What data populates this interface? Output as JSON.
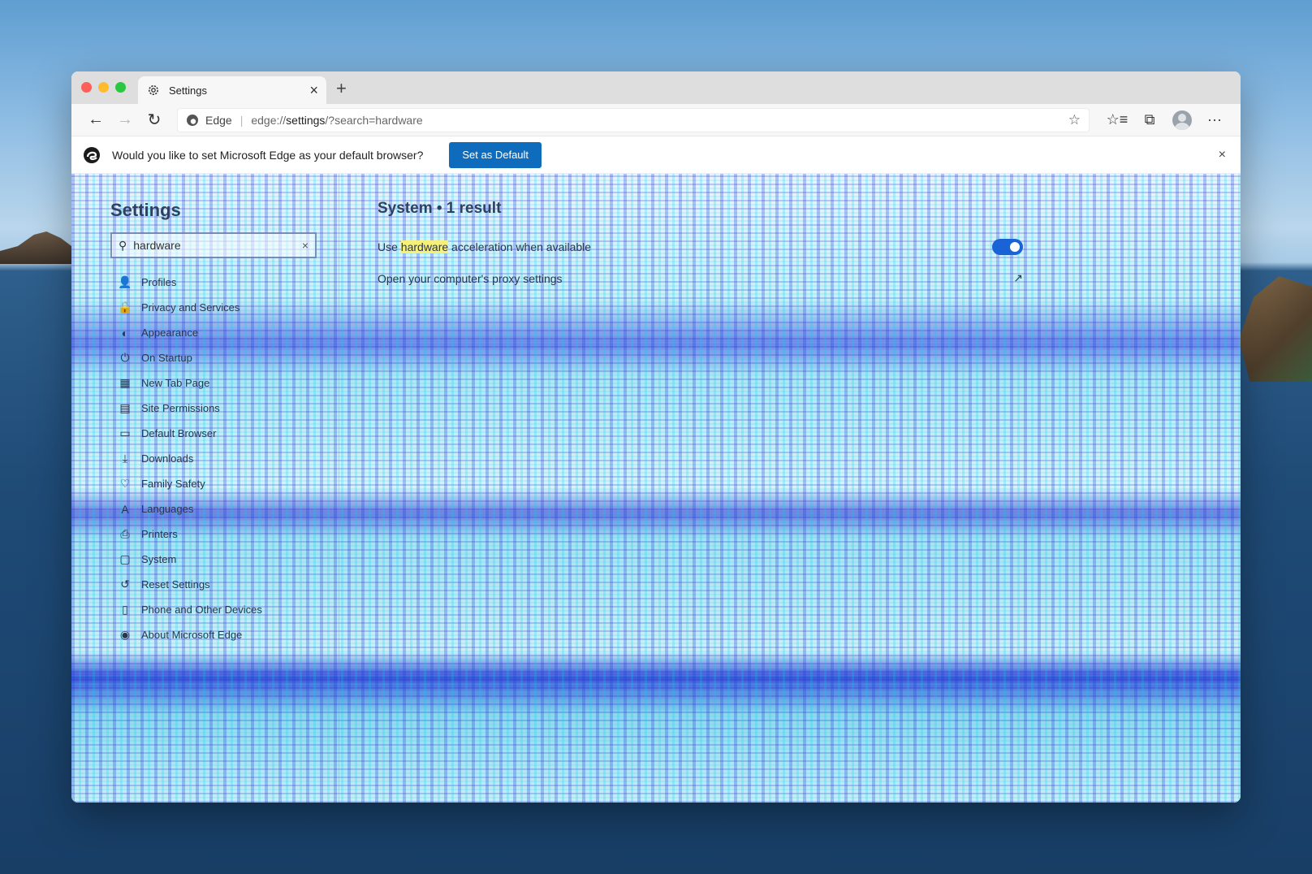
{
  "browser": {
    "tab": {
      "title": "Settings",
      "close": "×"
    },
    "new_tab": "+",
    "nav": {
      "back": "←",
      "forward": "→",
      "refresh": "↻"
    },
    "address": {
      "site_label": "Edge",
      "separator": "|",
      "url_prefix": "edge://",
      "url_host": "settings",
      "url_path": "/?search=hardware"
    },
    "toolbar_icons": {
      "favorite": "☆",
      "favorites_list": "☆≡",
      "collections": "⧉",
      "more": "···"
    }
  },
  "infobar": {
    "message": "Would you like to set Microsoft Edge as your default browser?",
    "button_label": "Set as Default",
    "close": "×"
  },
  "settings": {
    "title": "Settings",
    "search_value": "hardware",
    "search_clear": "×",
    "nav_items": [
      {
        "label": "Profiles",
        "icon": "👤"
      },
      {
        "label": "Privacy and Services",
        "icon": "🔒"
      },
      {
        "label": "Appearance",
        "icon": "◐"
      },
      {
        "label": "On Startup",
        "icon": "⏻"
      },
      {
        "label": "New Tab Page",
        "icon": "▦"
      },
      {
        "label": "Site Permissions",
        "icon": "▤"
      },
      {
        "label": "Default Browser",
        "icon": "▭"
      },
      {
        "label": "Downloads",
        "icon": "⤓"
      },
      {
        "label": "Family Safety",
        "icon": "♡"
      },
      {
        "label": "Languages",
        "icon": "A"
      },
      {
        "label": "Printers",
        "icon": "⎙"
      },
      {
        "label": "System",
        "icon": "▢"
      },
      {
        "label": "Reset Settings",
        "icon": "↺"
      },
      {
        "label": "Phone and Other Devices",
        "icon": "▯"
      },
      {
        "label": "About Microsoft Edge",
        "icon": "◉"
      }
    ],
    "result": {
      "title": "System • 1 result",
      "row1_prefix": "Use ",
      "row1_highlight": "hardware",
      "row1_suffix": " acceleration when available",
      "row2_label": "Open your computer's proxy settings",
      "row2_icon": "↗"
    }
  },
  "colors": {
    "accent": "#0f6cbd",
    "toggle_on": "#1a63d6",
    "highlight": "#f4f07a"
  }
}
